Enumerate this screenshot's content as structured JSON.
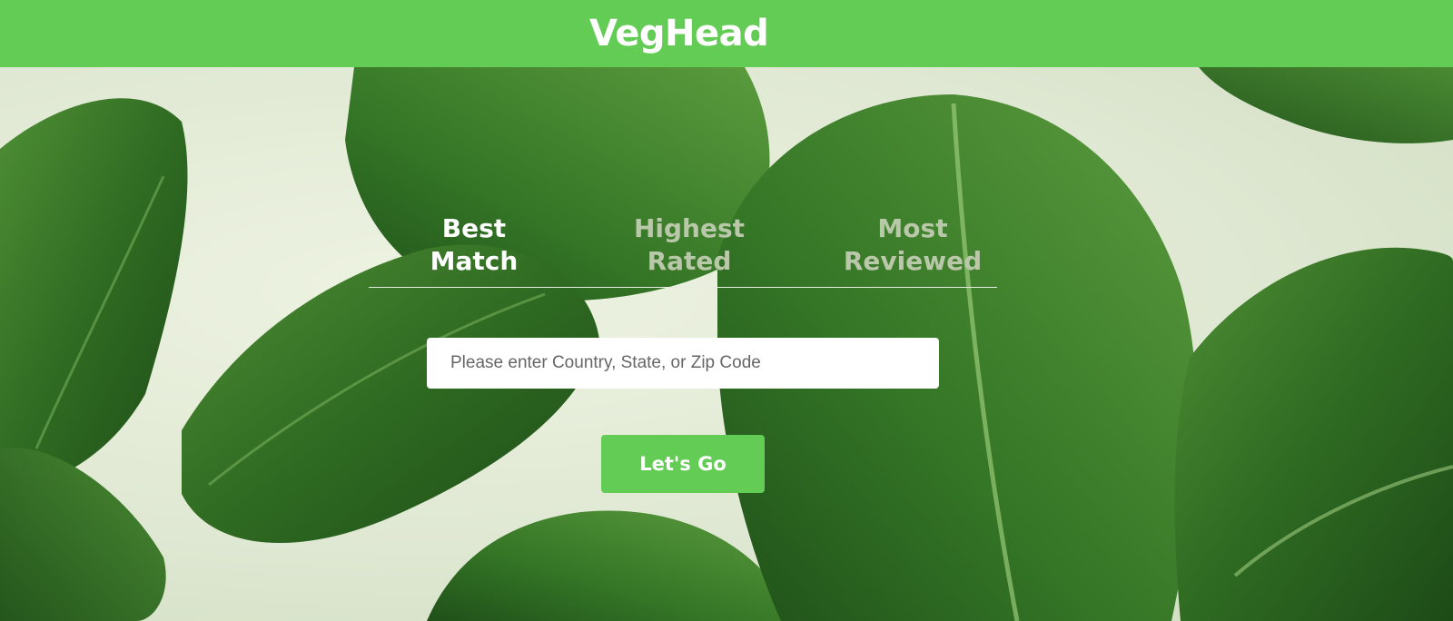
{
  "header": {
    "brand": "VegHead",
    "bg_color": "#62cc55"
  },
  "tabs": [
    {
      "label": "Best\nMatch",
      "active": true
    },
    {
      "label": "Highest\nRated",
      "active": false
    },
    {
      "label": "Most\nReviewed",
      "active": false
    }
  ],
  "search": {
    "placeholder": "Please enter Country, State, or Zip Code",
    "value": ""
  },
  "cta": {
    "label": "Let's Go"
  },
  "colors": {
    "accent": "#62cc55",
    "tab_active": "#ffffff",
    "tab_inactive": "#b9c8a9"
  }
}
